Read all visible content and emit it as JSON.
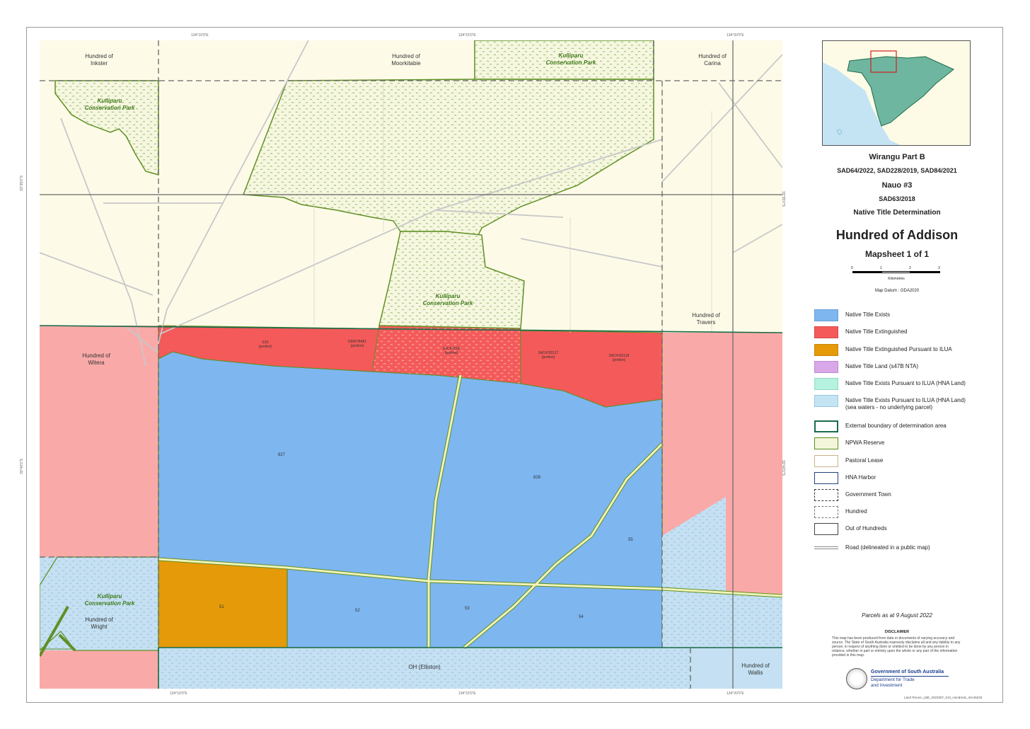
{
  "map": {
    "hundreds": {
      "inkster": "Hundred of\nInkster",
      "moorkitabie": "Hundred of\nMoorkitabie",
      "carina": "Hundred of\nCarina",
      "witera": "Hundred of\nWitera",
      "travers": "Hundred of\nTravers",
      "wright": "Hundred of\nWright",
      "wallis": "Hundred of\nWallis"
    },
    "conservation_park": "Kulliparu\nConservation Park",
    "town": "OH (Elliston)",
    "parcels": {
      "p827": "827",
      "p828": "828",
      "p51": "51",
      "p52": "52",
      "p53": "53",
      "p54": "54",
      "p55": "55",
      "p_s10": "S10\n(portion)",
      "p_mid1": "D00078481\n(portion)",
      "p_mid2": "S4C4761B\n(portion)",
      "p_mid3": "S4C4762117\n(portion)",
      "p_mid4": "S4C4762118\n(portion)"
    },
    "edge_ticks": {
      "top_left": "134°10'0\"E",
      "top_mid": "134°15'0\"E",
      "top_right": "134°20'0\"E",
      "bot_left": "134°10'0\"E",
      "bot_mid": "134°15'0\"E",
      "bot_right": "134°20'0\"E",
      "left_top": "33°35'0\"S",
      "left_bot": "33°40'0\"S",
      "right_top": "33°35'0\"S",
      "right_bot": "33°40'0\"S"
    }
  },
  "title_block": {
    "l1": "Wirangu Part B",
    "l2": "SAD64/2022, SAD228/2019, SAD84/2021",
    "l3": "Nauo #3",
    "l4": "SAD63/2018",
    "l5": "Native Title Determination",
    "main": "Hundred of Addison",
    "sheet": "Mapsheet 1 of 1"
  },
  "scale": {
    "ticks": [
      "0",
      "1",
      "2",
      "3"
    ],
    "unit": "Kilometres",
    "datum": "Map Datum : GDA2020"
  },
  "legend": [
    {
      "label": "Native Title Exists",
      "fill": "#7eb6f0",
      "border": "#6a9fd8"
    },
    {
      "label": "Native Title Extinguished",
      "fill": "#f45a5a",
      "border": "#d84848"
    },
    {
      "label": "Native Title Extinguished Pursuant to ILUA",
      "fill": "#e59a0a",
      "border": "#c98508"
    },
    {
      "label": "Native Title Land (s47B NTA)",
      "fill": "#d9a8e8",
      "border": "#b98ad0"
    },
    {
      "label": "Native Title Exists Pursuant to ILUA (HNA Land)",
      "fill": "#b6f2e0",
      "border": "#8fd8c2"
    },
    {
      "label": "Native Title Exists Pursuant to ILUA (HNA Land)\n(sea waters - no underlying parcel)",
      "fill": "#c4e4f4",
      "border": "#98c8e4"
    },
    {
      "label": "External boundary of determination area",
      "fill": "#ffffff",
      "border": "#1a6b4a"
    },
    {
      "label": "NPWA Reserve",
      "fill": "#f4f6dc",
      "border": "#5c8f1c"
    },
    {
      "label": "Pastoral Lease",
      "fill": "#ffffff",
      "border": "#c8b48a"
    },
    {
      "label": "HNA Harbor",
      "fill": "#ffffff",
      "border": "#24417a"
    },
    {
      "label": "Government Town",
      "fill": "#ffffff",
      "border": "#333333"
    },
    {
      "label": "Hundred",
      "fill": "#ffffff",
      "border": "#777777"
    },
    {
      "label": "Out of Hundreds",
      "fill": "#ffffff",
      "border": "#444444"
    },
    {
      "label": "Road (delineated in a public map)",
      "fill": "none",
      "border": "#888888"
    }
  ],
  "parcels_note": "Parcels as at 9 August 2022",
  "disclaimer_title": "DISCLAIMER",
  "disclaimer_text": "This map has been produced from data or documents of varying accuracy and source. The State of South Australia expressly disclaims all and any liability to any person, in respect of anything done or omitted to be done by any person in reliance, whether in part or entirely upon the whole or any part of the information provided in this map.",
  "gov": {
    "line1": "Government of South Australia",
    "line2": "Department for Trade\nand Investment"
  },
  "footer_ref": "Land Tenure_LBE_2022007_013_Hundreds_ISA45225"
}
